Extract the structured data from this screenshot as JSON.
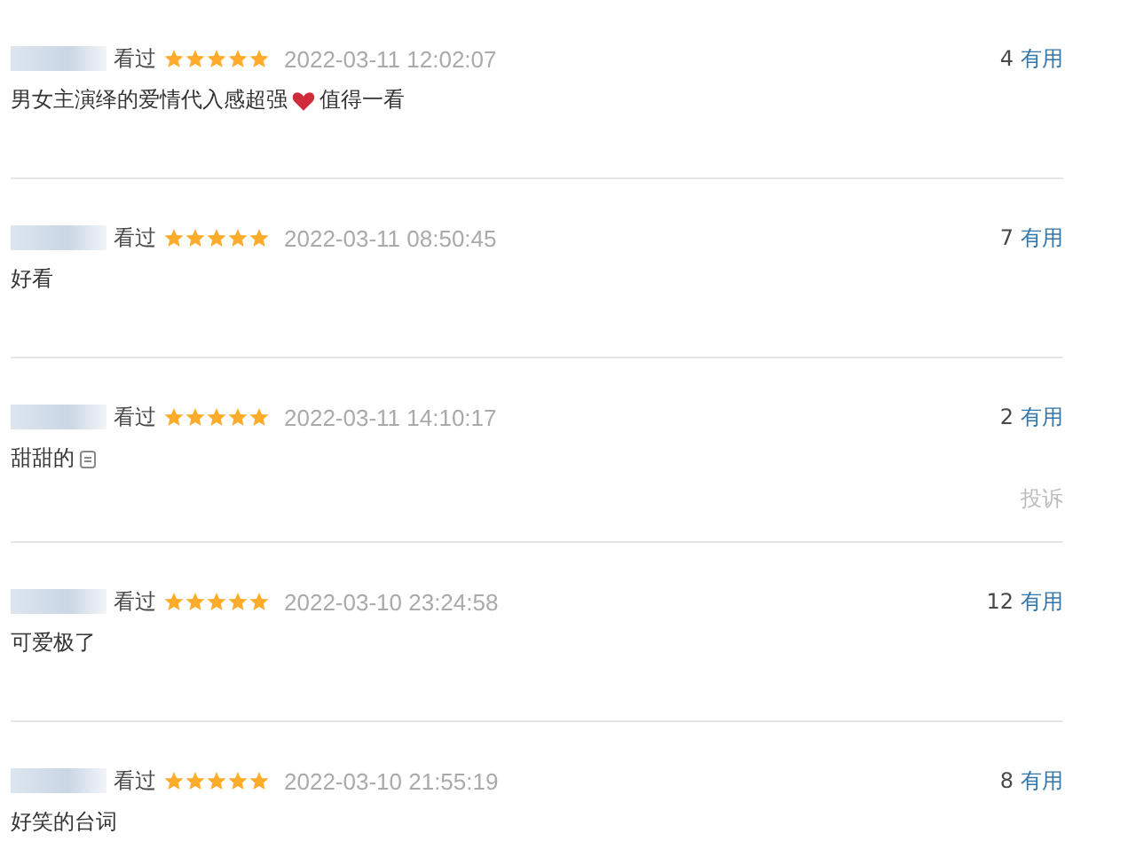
{
  "comments": [
    {
      "watched": "看过",
      "stars": 5,
      "time": "2022-03-11 12:02:07",
      "useful_count": "4",
      "useful_label": "有用",
      "content": [
        {
          "kind": "text",
          "text": "男女主演绎的爱情代入感超强"
        },
        {
          "kind": "heart"
        },
        {
          "kind": "text",
          "text": "值得一看"
        }
      ]
    },
    {
      "watched": "看过",
      "stars": 5,
      "time": "2022-03-11 08:50:45",
      "useful_count": "7",
      "useful_label": "有用",
      "content": [
        {
          "kind": "text",
          "text": "好看"
        }
      ]
    },
    {
      "watched": "看过",
      "stars": 5,
      "time": "2022-03-11 14:10:17",
      "useful_count": "2",
      "useful_label": "有用",
      "content": [
        {
          "kind": "text",
          "text": "甜甜的"
        },
        {
          "kind": "emoji"
        }
      ],
      "report": "投诉"
    },
    {
      "watched": "看过",
      "stars": 5,
      "time": "2022-03-10 23:24:58",
      "useful_count": "12",
      "useful_label": "有用",
      "content": [
        {
          "kind": "text",
          "text": "可爱极了"
        }
      ]
    },
    {
      "watched": "看过",
      "stars": 5,
      "time": "2022-03-10 21:55:19",
      "useful_count": "8",
      "useful_label": "有用",
      "content": [
        {
          "kind": "text",
          "text": "好笑的台词"
        }
      ]
    }
  ]
}
